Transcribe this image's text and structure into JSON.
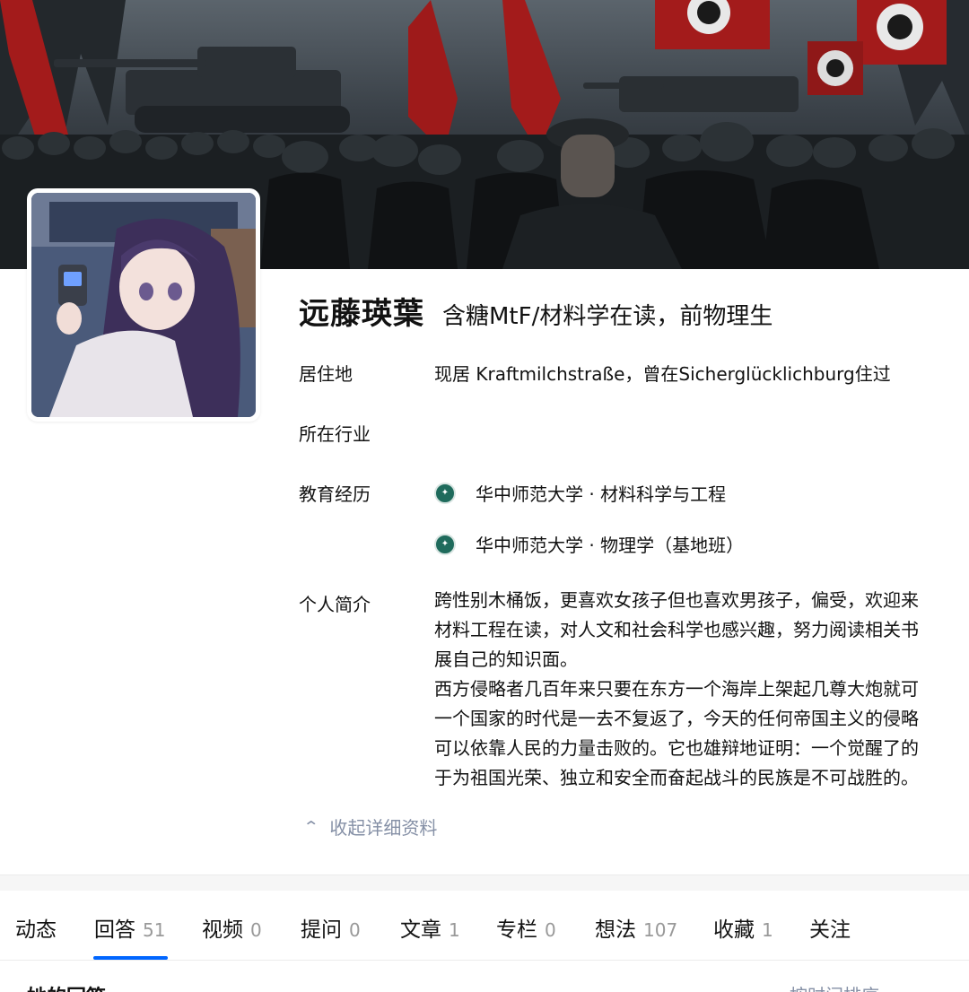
{
  "profile": {
    "name": "远藤瑛葉",
    "headline": "含糖MtF/材料学在读，前物理生"
  },
  "details": {
    "residence_label": "居住地",
    "residence_value": "现居 Kraftmilchstraße，曾在Sicherglücklichburg住过",
    "industry_label": "所在行业",
    "education_label": "教育经历",
    "education": [
      {
        "text": "华中师范大学 · 材料科学与工程",
        "logo_icon": "university-logo-icon"
      },
      {
        "text": "华中师范大学 · 物理学（基地班）",
        "logo_icon": "university-logo-icon"
      }
    ],
    "bio_label": "个人简介",
    "bio_lines": [
      "跨性别木桶饭，更喜欢女孩子但也喜欢男孩子，偏受，欢迎来",
      "材料工程在读，对人文和社会科学也感兴趣，努力阅读相关书",
      "展自己的知识面。",
      "西方侵略者几百年来只要在东方一个海岸上架起几尊大炮就可",
      "一个国家的时代是一去不复返了，今天的任何帝国主义的侵略",
      "可以依靠人民的力量击败的。它也雄辩地证明：一个觉醒了的",
      "于为祖国光荣、独立和安全而奋起战斗的民族是不可战胜的。"
    ]
  },
  "collapse": {
    "label": "收起详细资料",
    "icon": "chevron-up-icon"
  },
  "tabs": [
    {
      "label": "动态",
      "count": ""
    },
    {
      "label": "回答",
      "count": "51",
      "active": true
    },
    {
      "label": "视频",
      "count": "0"
    },
    {
      "label": "提问",
      "count": "0"
    },
    {
      "label": "文章",
      "count": "1"
    },
    {
      "label": "专栏",
      "count": "0"
    },
    {
      "label": "想法",
      "count": "107"
    },
    {
      "label": "收藏",
      "count": "1"
    },
    {
      "label": "关注",
      "count": ""
    }
  ],
  "answers_section": {
    "title": "她的回答",
    "sort_label": "按时间排序"
  },
  "colors": {
    "accent": "#0066ff",
    "muted": "#8590a6",
    "count": "#999999",
    "cover_flag": "#a31b1b"
  }
}
